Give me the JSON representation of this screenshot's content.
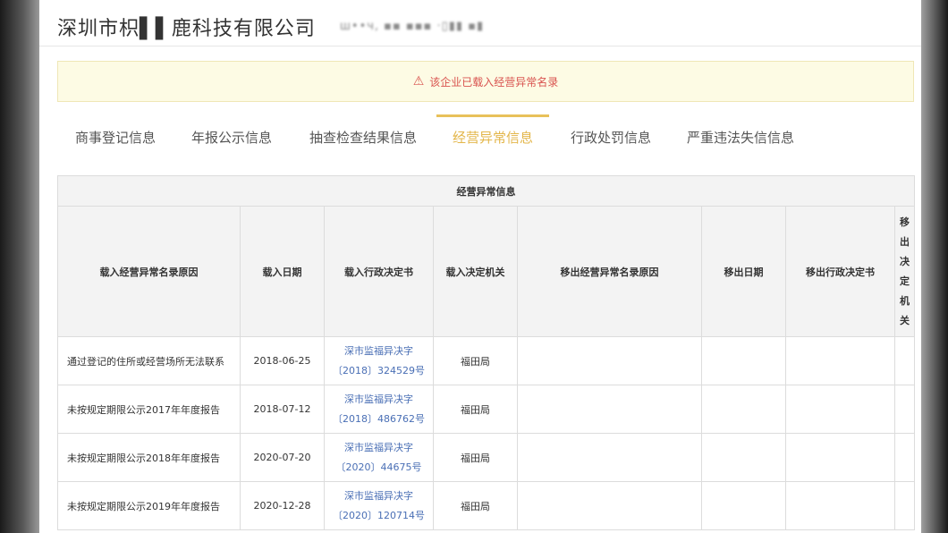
{
  "company": {
    "name": "深圳市枳▌▌鹿科技有限公司",
    "code": "ш••ч, ▪▪ ▪▪▪ ·▯▮▮ ▪▮"
  },
  "alert": {
    "icon": "warning-icon",
    "text": "该企业已载入经营异常名录",
    "color": "#d9534f"
  },
  "tabs": [
    {
      "label": "商事登记信息",
      "active": false
    },
    {
      "label": "年报公示信息",
      "active": false
    },
    {
      "label": "抽查检查结果信息",
      "active": false
    },
    {
      "label": "经营异常信息",
      "active": true
    },
    {
      "label": "行政处罚信息",
      "active": false
    },
    {
      "label": "严重违法失信信息",
      "active": false
    }
  ],
  "table": {
    "caption": "经营异常信息",
    "headers": [
      "载入经营异常名录原因",
      "载入日期",
      "载入行政决定书",
      "载入决定机关",
      "移出经营异常名录原因",
      "移出日期",
      "移出行政决定书",
      "移出决定机关"
    ],
    "rows": [
      {
        "reason": "通过登记的住所或经营场所无法联系",
        "date": "2018-06-25",
        "decision_line1": "深市监福异决字",
        "decision_line2": "〔2018〕324529号",
        "authority": "福田局"
      },
      {
        "reason": "未按规定期限公示2017年年度报告",
        "date": "2018-07-12",
        "decision_line1": "深市监福异决字",
        "decision_line2": "〔2018〕486762号",
        "authority": "福田局"
      },
      {
        "reason": "未按规定期限公示2018年年度报告",
        "date": "2020-07-20",
        "decision_line1": "深市监福异决字",
        "decision_line2": "〔2020〕44675号",
        "authority": "福田局"
      },
      {
        "reason": "未按规定期限公示2019年年度报告",
        "date": "2020-12-28",
        "decision_line1": "深市监福异决字",
        "decision_line2": "〔2020〕120714号",
        "authority": "福田局"
      }
    ]
  },
  "colors": {
    "accent_tab": "#e3b64a",
    "link": "#4a6fb5",
    "alert_bg": "#fdfbe4"
  }
}
